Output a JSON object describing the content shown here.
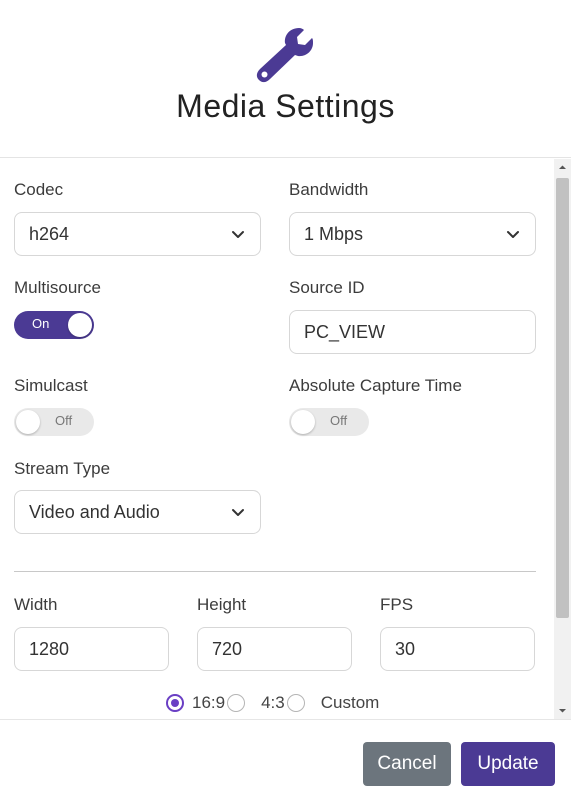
{
  "header": {
    "icon": "wrench-icon",
    "title": "Media Settings"
  },
  "codec": {
    "label": "Codec",
    "value": "h264"
  },
  "bandwidth": {
    "label": "Bandwidth",
    "value": "1 Mbps"
  },
  "multisource": {
    "label": "Multisource",
    "state": "On"
  },
  "source_id": {
    "label": "Source ID",
    "value": "PC_VIEW"
  },
  "simulcast": {
    "label": "Simulcast",
    "state": "Off"
  },
  "absolute_capture_time": {
    "label": "Absolute Capture Time",
    "state": "Off"
  },
  "stream_type": {
    "label": "Stream Type",
    "value": "Video and Audio"
  },
  "width": {
    "label": "Width",
    "value": "1280"
  },
  "height": {
    "label": "Height",
    "value": "720"
  },
  "fps": {
    "label": "FPS",
    "value": "30"
  },
  "aspect_ratio": {
    "options": [
      "16:9",
      "4:3",
      "Custom"
    ],
    "selected": "16:9"
  },
  "footer": {
    "cancel_label": "Cancel",
    "update_label": "Update"
  },
  "colors": {
    "accent": "#4b3a94",
    "radio_accent": "#6a3fc4",
    "cancel_button": "#6c757d"
  }
}
